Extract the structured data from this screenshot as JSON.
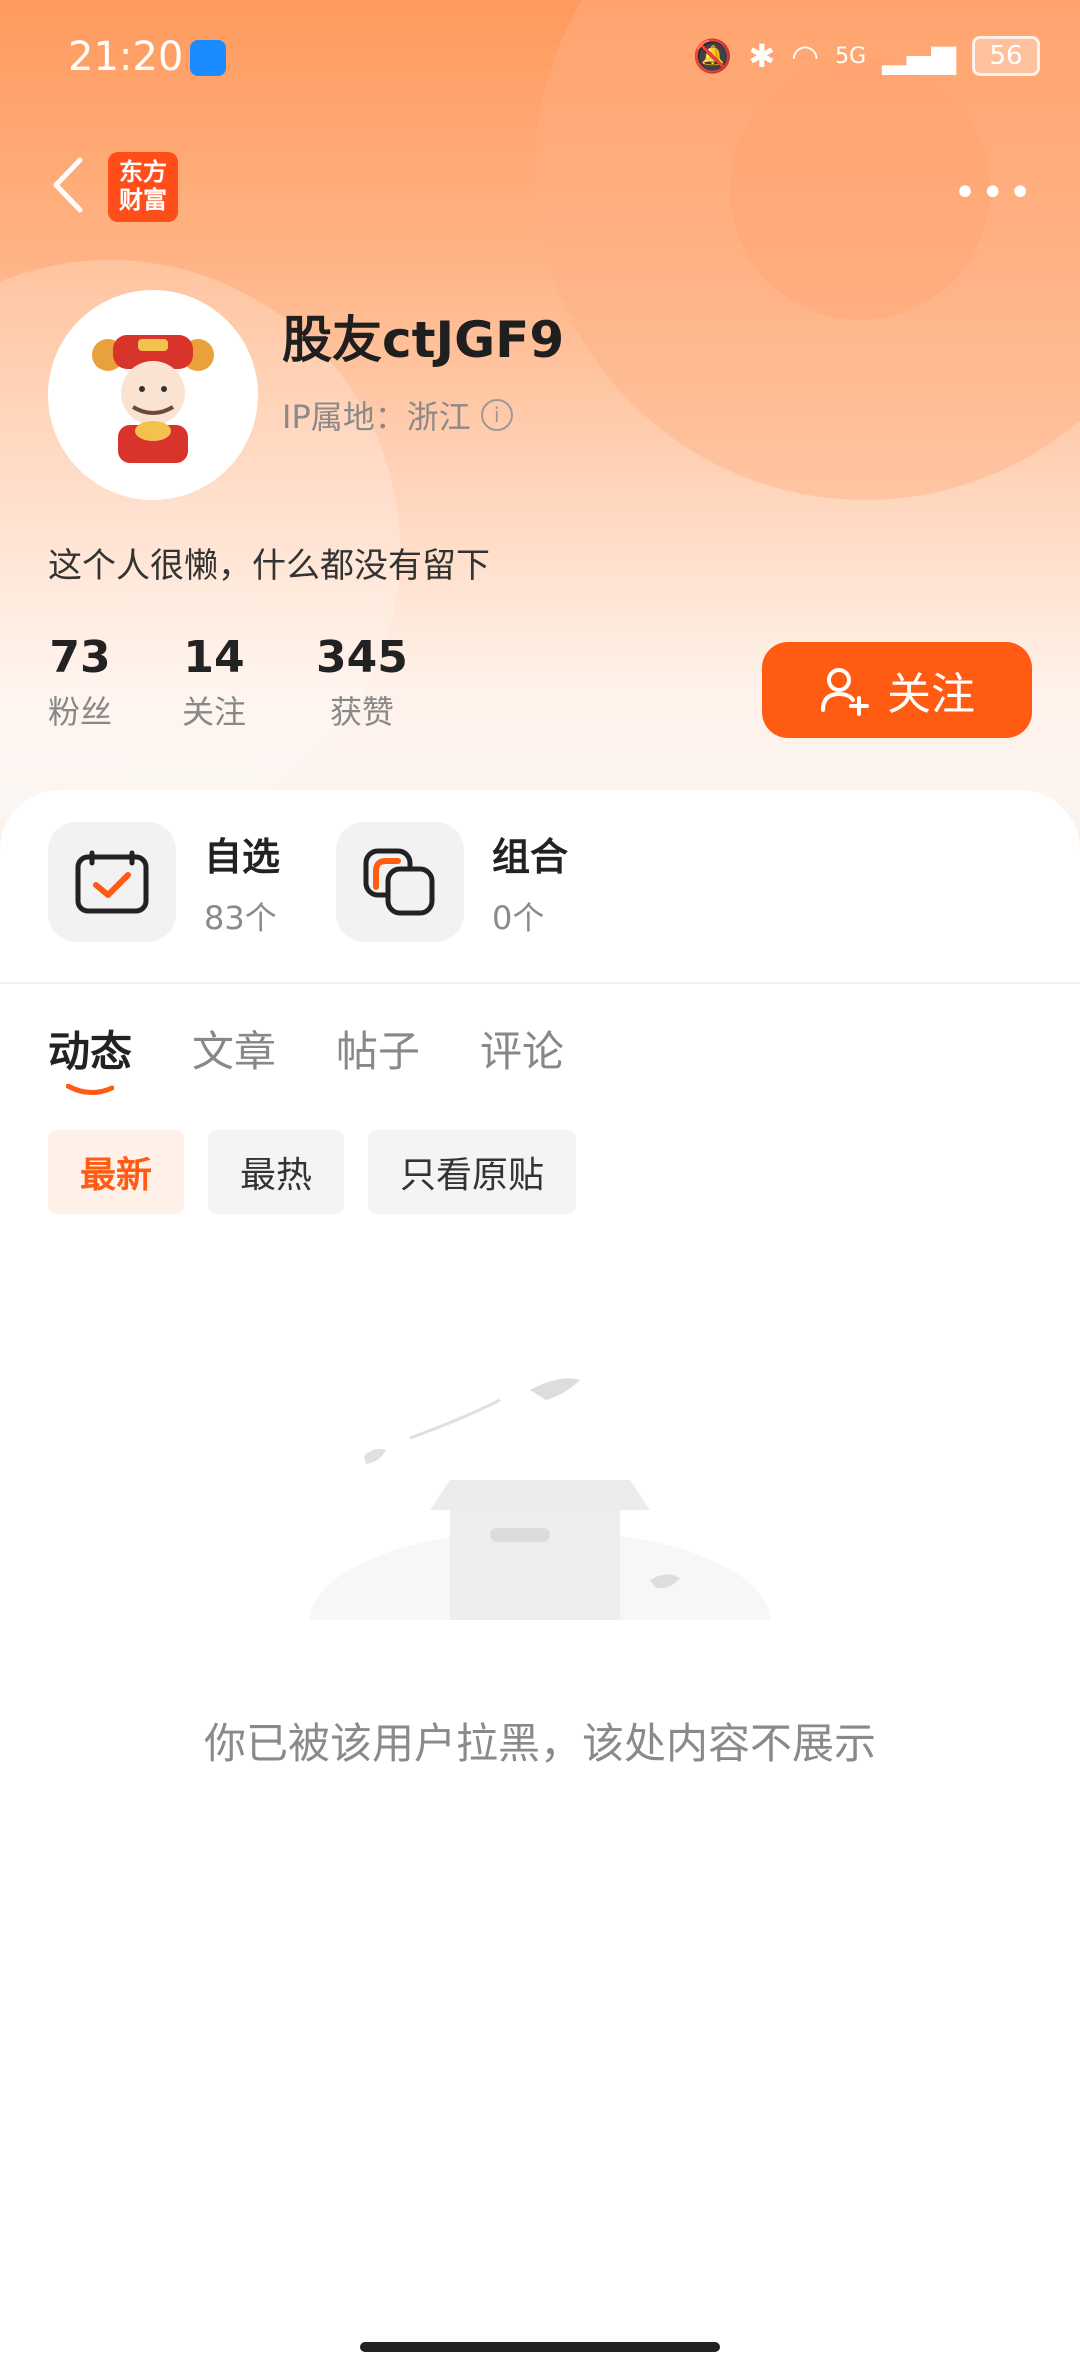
{
  "status_bar": {
    "time": "21:20",
    "network": "5G",
    "battery": "56"
  },
  "nav": {
    "logo_line1": "东方",
    "logo_line2": "财富"
  },
  "profile": {
    "username": "股友ctJGF9",
    "ip_location": "IP属地：浙江",
    "bio": "这个人很懒，什么都没有留下",
    "stats": [
      {
        "value": "73",
        "label": "粉丝"
      },
      {
        "value": "14",
        "label": "关注"
      },
      {
        "value": "345",
        "label": "获赞"
      }
    ],
    "follow_label": "关注"
  },
  "cards": [
    {
      "title": "自选",
      "sub": "83个"
    },
    {
      "title": "组合",
      "sub": "0个"
    }
  ],
  "tabs": [
    "动态",
    "文章",
    "帖子",
    "评论"
  ],
  "filters": [
    "最新",
    "最热",
    "只看原贴"
  ],
  "empty_message": "你已被该用户拉黑，该处内容不展示",
  "colors": {
    "accent": "#ff5b12",
    "header_top": "#ff9a5e"
  }
}
